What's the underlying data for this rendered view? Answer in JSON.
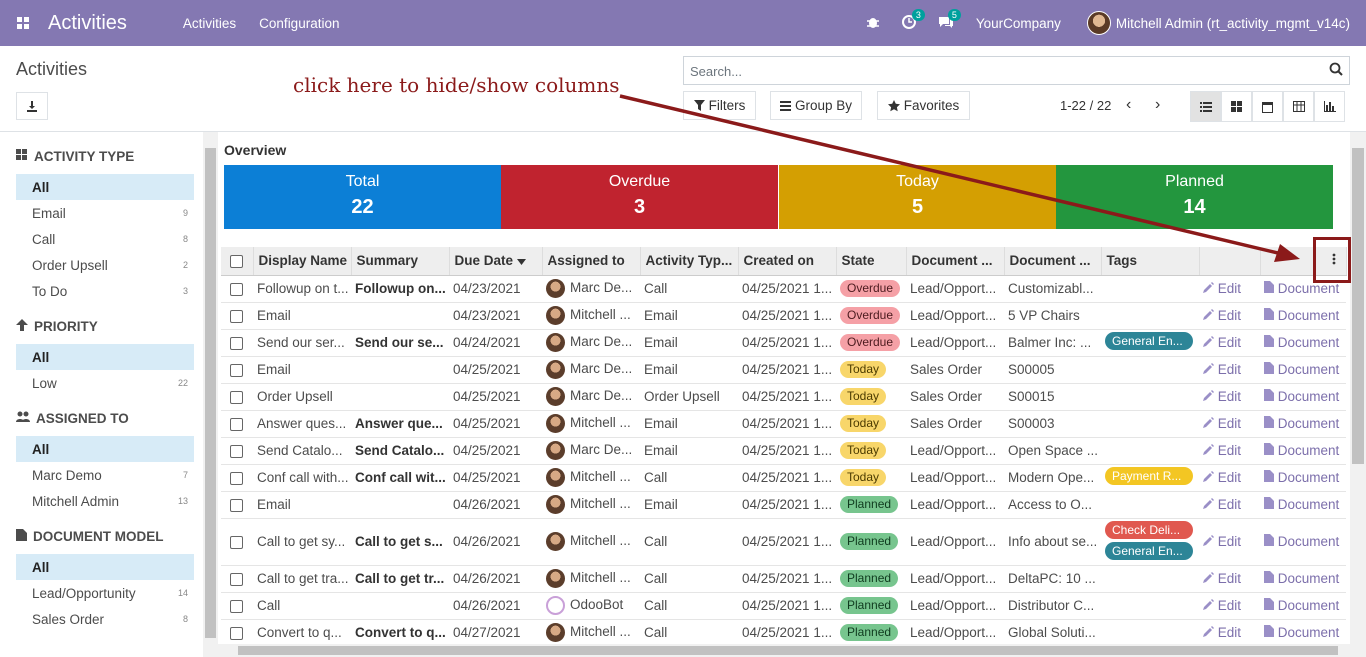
{
  "app": {
    "title": "Activities"
  },
  "menus": [
    "Activities",
    "Configuration"
  ],
  "systray": {
    "activity_badge": "3",
    "message_badge": "5",
    "company": "YourCompany",
    "user": "Mitchell Admin (rt_activity_mgmt_v14c)"
  },
  "breadcrumb": "Activities",
  "search": {
    "placeholder": "Search..."
  },
  "filters": {
    "filters": "Filters",
    "groupby": "Group By",
    "favorites": "Favorites"
  },
  "pager": {
    "text": "1-22 / 22"
  },
  "annotation": "click here to hide/show columns",
  "sidebar": {
    "sections": [
      {
        "title": "ACTIVITY TYPE",
        "items": [
          {
            "label": "All",
            "count": ""
          },
          {
            "label": "Email",
            "count": "9"
          },
          {
            "label": "Call",
            "count": "8"
          },
          {
            "label": "Order Upsell",
            "count": "2"
          },
          {
            "label": "To Do",
            "count": "3"
          }
        ]
      },
      {
        "title": "PRIORITY",
        "items": [
          {
            "label": "All",
            "count": ""
          },
          {
            "label": "Low",
            "count": "22"
          }
        ]
      },
      {
        "title": "ASSIGNED TO",
        "items": [
          {
            "label": "All",
            "count": ""
          },
          {
            "label": "Marc Demo",
            "count": "7"
          },
          {
            "label": "Mitchell Admin",
            "count": "13"
          }
        ]
      },
      {
        "title": "DOCUMENT MODEL",
        "items": [
          {
            "label": "All",
            "count": ""
          },
          {
            "label": "Lead/Opportunity",
            "count": "14"
          },
          {
            "label": "Sales Order",
            "count": "8"
          }
        ]
      }
    ]
  },
  "overview": {
    "title": "Overview",
    "tiles": [
      {
        "label": "Total",
        "value": "22",
        "color": "#0c7fd6"
      },
      {
        "label": "Overdue",
        "value": "3",
        "color": "#c0232f"
      },
      {
        "label": "Today",
        "value": "5",
        "color": "#d49f02"
      },
      {
        "label": "Planned",
        "value": "14",
        "color": "#23963e"
      }
    ]
  },
  "table": {
    "headers": [
      "Display Name",
      "Summary",
      "Due Date",
      "Assigned to",
      "Activity Typ...",
      "Created on",
      "State",
      "Document ...",
      "Document ...",
      "Tags"
    ],
    "edit_label": "Edit",
    "doc_label": "Document",
    "rows": [
      {
        "name": "Followup on t...",
        "summary": "Followup on...",
        "due": "04/23/2021",
        "assigned": "Marc De...",
        "type": "Call",
        "created": "04/25/2021 1...",
        "state": "Overdue",
        "model": "Lead/Opport...",
        "doc": "Customizabl...",
        "tags": []
      },
      {
        "name": "Email",
        "summary": "",
        "due": "04/23/2021",
        "assigned": "Mitchell ...",
        "type": "Email",
        "created": "04/25/2021 1...",
        "state": "Overdue",
        "model": "Lead/Opport...",
        "doc": "5 VP Chairs",
        "tags": []
      },
      {
        "name": "Send our ser...",
        "summary": "Send our se...",
        "due": "04/24/2021",
        "assigned": "Marc De...",
        "type": "Email",
        "created": "04/25/2021 1...",
        "state": "Overdue",
        "model": "Lead/Opport...",
        "doc": "Balmer Inc: ...",
        "tags": [
          {
            "label": "General En...",
            "color": "teal"
          }
        ]
      },
      {
        "name": "Email",
        "summary": "",
        "due": "04/25/2021",
        "assigned": "Marc De...",
        "type": "Email",
        "created": "04/25/2021 1...",
        "state": "Today",
        "model": "Sales Order",
        "doc": "S00005",
        "tags": []
      },
      {
        "name": "Order Upsell",
        "summary": "",
        "due": "04/25/2021",
        "assigned": "Marc De...",
        "type": "Order Upsell",
        "created": "04/25/2021 1...",
        "state": "Today",
        "model": "Sales Order",
        "doc": "S00015",
        "tags": []
      },
      {
        "name": "Answer ques...",
        "summary": "Answer que...",
        "due": "04/25/2021",
        "assigned": "Mitchell ...",
        "type": "Email",
        "created": "04/25/2021 1...",
        "state": "Today",
        "model": "Sales Order",
        "doc": "S00003",
        "tags": []
      },
      {
        "name": "Send Catalo...",
        "summary": "Send Catalo...",
        "due": "04/25/2021",
        "assigned": "Marc De...",
        "type": "Email",
        "created": "04/25/2021 1...",
        "state": "Today",
        "model": "Lead/Opport...",
        "doc": "Open Space ...",
        "tags": []
      },
      {
        "name": "Conf call with...",
        "summary": "Conf call wit...",
        "due": "04/25/2021",
        "assigned": "Mitchell ...",
        "type": "Call",
        "created": "04/25/2021 1...",
        "state": "Today",
        "model": "Lead/Opport...",
        "doc": "Modern Ope...",
        "tags": [
          {
            "label": "Payment R...",
            "color": "yel"
          }
        ]
      },
      {
        "name": "Email",
        "summary": "",
        "due": "04/26/2021",
        "assigned": "Mitchell ...",
        "type": "Email",
        "created": "04/25/2021 1...",
        "state": "Planned",
        "model": "Lead/Opport...",
        "doc": "Access to O...",
        "tags": []
      },
      {
        "name": "Call to get sy...",
        "summary": "Call to get s...",
        "due": "04/26/2021",
        "assigned": "Mitchell ...",
        "type": "Call",
        "created": "04/25/2021 1...",
        "state": "Planned",
        "model": "Lead/Opport...",
        "doc": "Info about se...",
        "tags": [
          {
            "label": "Check Deli...",
            "color": "red"
          },
          {
            "label": "General En...",
            "color": "teal"
          }
        ]
      },
      {
        "name": "Call to get tra...",
        "summary": "Call to get tr...",
        "due": "04/26/2021",
        "assigned": "Mitchell ...",
        "type": "Call",
        "created": "04/25/2021 1...",
        "state": "Planned",
        "model": "Lead/Opport...",
        "doc": "DeltaPC: 10 ...",
        "tags": []
      },
      {
        "name": "Call",
        "summary": "",
        "due": "04/26/2021",
        "assigned": "OdooBot",
        "type": "Call",
        "created": "04/25/2021 1...",
        "state": "Planned",
        "model": "Lead/Opport...",
        "doc": "Distributor C...",
        "tags": []
      },
      {
        "name": "Convert to q...",
        "summary": "Convert to q...",
        "due": "04/27/2021",
        "assigned": "Mitchell ...",
        "type": "Call",
        "created": "04/25/2021 1...",
        "state": "Planned",
        "model": "Lead/Opport...",
        "doc": "Global Soluti...",
        "tags": []
      }
    ]
  }
}
